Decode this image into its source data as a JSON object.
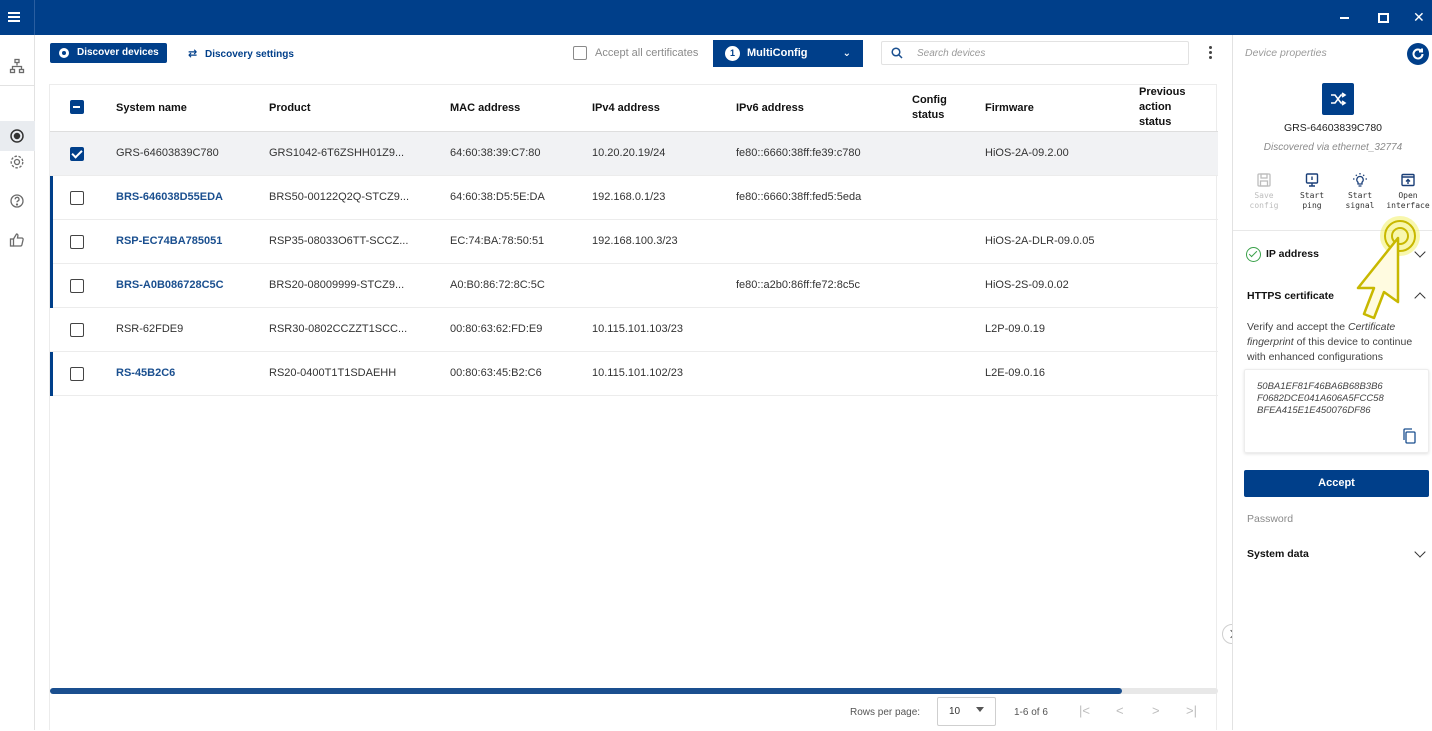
{
  "toolbar": {
    "discover_label": "Discover devices",
    "discovery_settings_label": "Discovery settings",
    "accept_all_label": "Accept all certificates",
    "multiconfig_count": "1",
    "multiconfig_label": "MultiConfig",
    "search_placeholder": "Search devices"
  },
  "table": {
    "columns": {
      "system_name": "System name",
      "product": "Product",
      "mac": "MAC address",
      "ipv4": "IPv4 address",
      "ipv6": "IPv6 address",
      "config_status": "Config status",
      "firmware": "Firmware",
      "prev_action": "Previous action status"
    },
    "rows": [
      {
        "name": "GRS-64603839C780",
        "product": "GRS1042-6T6ZSHH01Z9...",
        "mac": "64:60:38:39:C7:80",
        "ipv4": "10.20.20.19/24",
        "ipv6": "fe80::6660:38ff:fe39:c780",
        "firmware": "HiOS-2A-09.2.00"
      },
      {
        "name": "BRS-646038D55EDA",
        "product": "BRS50-00122Q2Q-STCZ9...",
        "mac": "64:60:38:D5:5E:DA",
        "ipv4": "192.168.0.1/23",
        "ipv6": "fe80::6660:38ff:fed5:5eda",
        "firmware": ""
      },
      {
        "name": "RSP-EC74BA785051",
        "product": "RSP35-08033O6TT-SCCZ...",
        "mac": "EC:74:BA:78:50:51",
        "ipv4": "192.168.100.3/23",
        "ipv6": "",
        "firmware": "HiOS-2A-DLR-09.0.05"
      },
      {
        "name": "BRS-A0B086728C5C",
        "product": "BRS20-08009999-STCZ9...",
        "mac": "A0:B0:86:72:8C:5C",
        "ipv4": "",
        "ipv6": "fe80::a2b0:86ff:fe72:8c5c",
        "firmware": "HiOS-2S-09.0.02"
      },
      {
        "name": "RSR-62FDE9",
        "product": "RSR30-0802CCZZT1SCC...",
        "mac": "00:80:63:62:FD:E9",
        "ipv4": "10.115.101.103/23",
        "ipv6": "",
        "firmware": "L2P-09.0.19"
      },
      {
        "name": "RS-45B2C6",
        "product": "RS20-0400T1T1SDAEHH",
        "mac": "00:80:63:45:B2:C6",
        "ipv4": "10.115.101.102/23",
        "ipv6": "",
        "firmware": "L2E-09.0.16"
      }
    ]
  },
  "pagination": {
    "rows_per_page_label": "Rows per page:",
    "rows_per_page_value": "10",
    "range": "1-6 of 6"
  },
  "side_panel": {
    "title": "Device properties",
    "device_name": "GRS-64603839C780",
    "discovered_via": "Discovered via ethernet_32774",
    "actions": [
      {
        "line1": "Save",
        "line2": "config"
      },
      {
        "line1": "Start",
        "line2": "ping"
      },
      {
        "line1": "Start",
        "line2": "signal"
      },
      {
        "line1": "Open",
        "line2": "interface"
      }
    ],
    "ip_address_label": "IP address",
    "https_label": "HTTPS certificate",
    "verify_prefix": "Verify and accept the ",
    "verify_em": "Certificate fingerprint",
    "verify_suffix": " of this device to continue with enhanced configurations",
    "fingerprint_lines": [
      "50BA1EF81F46BA6B68B3B6",
      "F0682DCE041A606A5FCC58",
      "BFEA415E1E450076DF86"
    ],
    "accept_label": "Accept",
    "password_label": "Password",
    "system_data_label": "System data"
  },
  "colors": {
    "brand": "#003f8a",
    "ok_green": "#3aa14a"
  }
}
